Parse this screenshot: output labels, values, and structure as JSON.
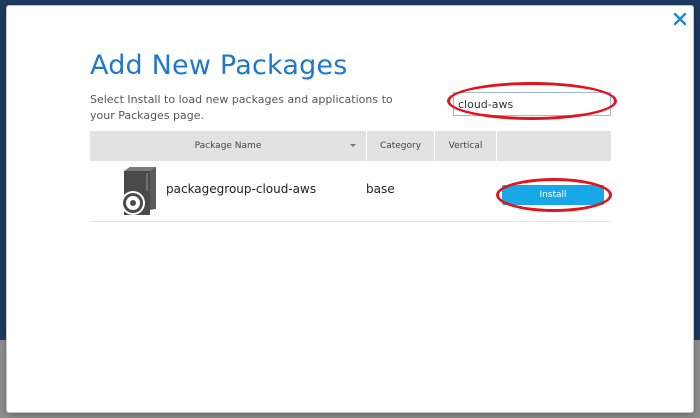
{
  "dialog": {
    "title": "Add New Packages",
    "subtitle": "Select Install to load new packages and applications to your Packages page.",
    "close_icon": "close-icon"
  },
  "search": {
    "value": "cloud-aws",
    "placeholder": ""
  },
  "table": {
    "columns": [
      "Package Name",
      "Category",
      "Vertical",
      ""
    ],
    "rows": [
      {
        "icon": "package-icon",
        "name": "packagegroup-cloud-aws",
        "category": "base",
        "vertical": "",
        "action_label": "Install"
      }
    ]
  },
  "colors": {
    "accent": "#1f78c8",
    "install_button": "#18a8e8",
    "annotation": "#e0141b",
    "header_bg": "#e2e2e2"
  }
}
